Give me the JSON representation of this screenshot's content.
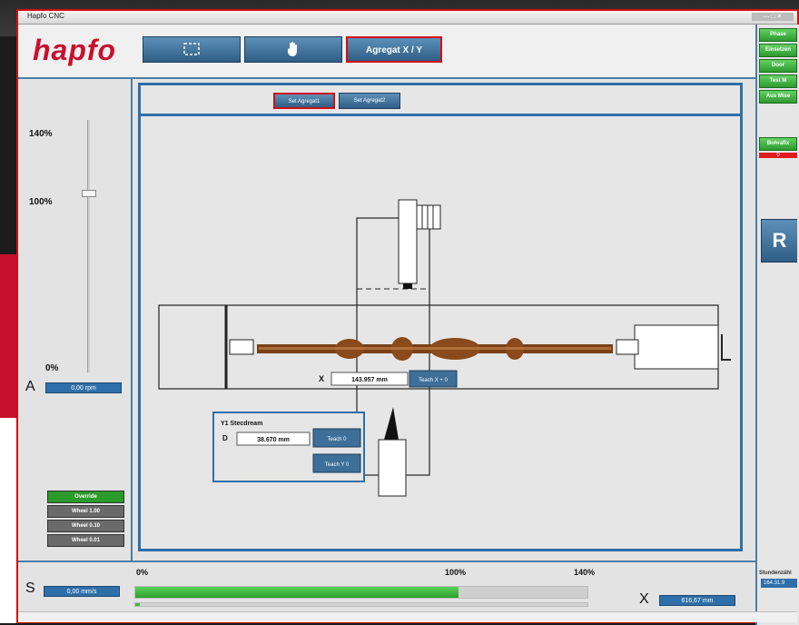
{
  "window": {
    "title": "Hapfo CNC"
  },
  "colors": {
    "accent": "#2f6fa9",
    "brand": "#c8102e",
    "status_green": "#3fb83f",
    "wood": "#7a4017"
  },
  "header": {
    "logo": "hapfo",
    "buttons": [
      {
        "label": "",
        "icon": "frame-icon"
      },
      {
        "label": "",
        "icon": "hand-icon"
      },
      {
        "label": "Agregat X / Y",
        "selected": true
      }
    ]
  },
  "right_panel": {
    "buttons": [
      "Phase",
      "Einsetzen",
      "Door",
      "Test M",
      "Aus Mise",
      "Bohrafix"
    ],
    "alarm_count": "0",
    "r_button": "R",
    "stunden_label": "Stundenzähl",
    "stunden_value": "164.31.9"
  },
  "left_panel": {
    "pct_top": "140%",
    "pct_mid": "100%",
    "pct_bottom": "0%",
    "slider_value": 1.0,
    "a_label": "A",
    "a_value": "0,00 rpm",
    "override_buttons": [
      "Override",
      "Wheel 1.00",
      "Wheel 0.10",
      "Wheel 0.01"
    ]
  },
  "main": {
    "aggregat_buttons": [
      "Set Agregat1",
      "Set Agregat2"
    ],
    "x_label": "X",
    "x_value": "143.957 mm",
    "x_button": "Teach X + 0",
    "y1": {
      "title": "Y1 Stecdream",
      "d_label": "D",
      "d_value": "38.670 mm",
      "teach1": "Teach 0",
      "teach2": "Teach Y 0"
    }
  },
  "bottom": {
    "s_label": "S",
    "s_value": "0,00 mm/s",
    "tick_0": "0%",
    "tick_100": "100%",
    "tick_140": "140%",
    "progress": 0.714,
    "progress2": 0.01,
    "x_label": "X",
    "x_value": "616,67 mm"
  }
}
